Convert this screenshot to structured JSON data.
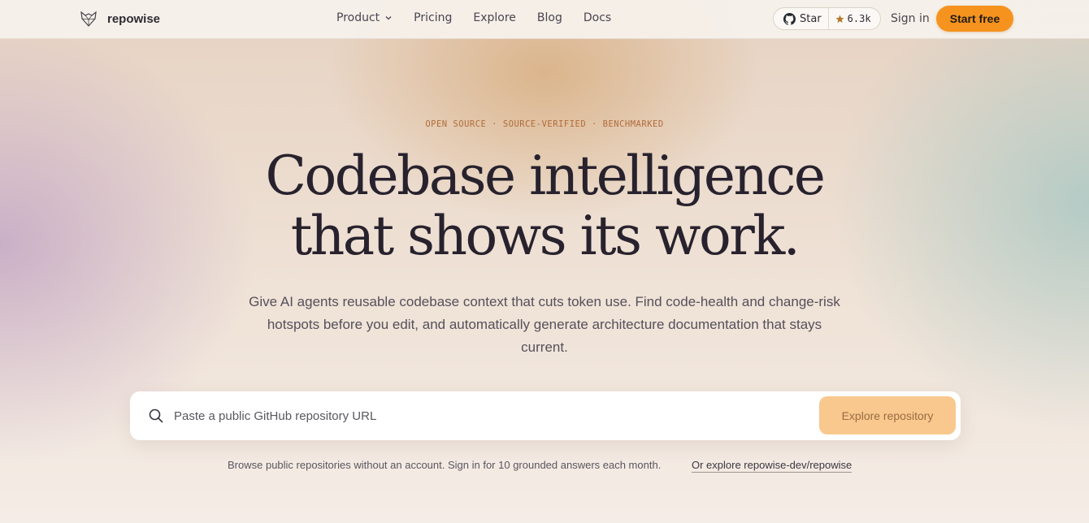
{
  "brand": {
    "name": "repowise",
    "logo_icon": "fox-logo-icon"
  },
  "nav": {
    "items": [
      {
        "label": "Product",
        "has_dropdown": true
      },
      {
        "label": "Pricing"
      },
      {
        "label": "Explore"
      },
      {
        "label": "Blog"
      },
      {
        "label": "Docs"
      }
    ],
    "github": {
      "label": "Star",
      "count": "6.3k"
    },
    "signin_label": "Sign in",
    "cta_label": "Start free"
  },
  "hero": {
    "eyebrow": "OPEN SOURCE · SOURCE-VERIFIED · BENCHMARKED",
    "headline_line1": "Codebase intelligence",
    "headline_line2": "that shows its work.",
    "subtitle": "Give AI agents reusable codebase context that cuts token use. Find code-health and change-risk hotspots before you edit, and automatically generate architecture documentation that stays current."
  },
  "search": {
    "placeholder": "Paste a public GitHub repository URL",
    "value": "",
    "button_label": "Explore repository"
  },
  "footnote": {
    "text": "Browse public repositories without an account. Sign in for 10 grounded answers each month.",
    "link_label": "Or explore repowise-dev/repowise"
  },
  "colors": {
    "accent": "#f6931f",
    "accent_soft": "#f8c88e",
    "eyebrow": "#b06b3a"
  }
}
